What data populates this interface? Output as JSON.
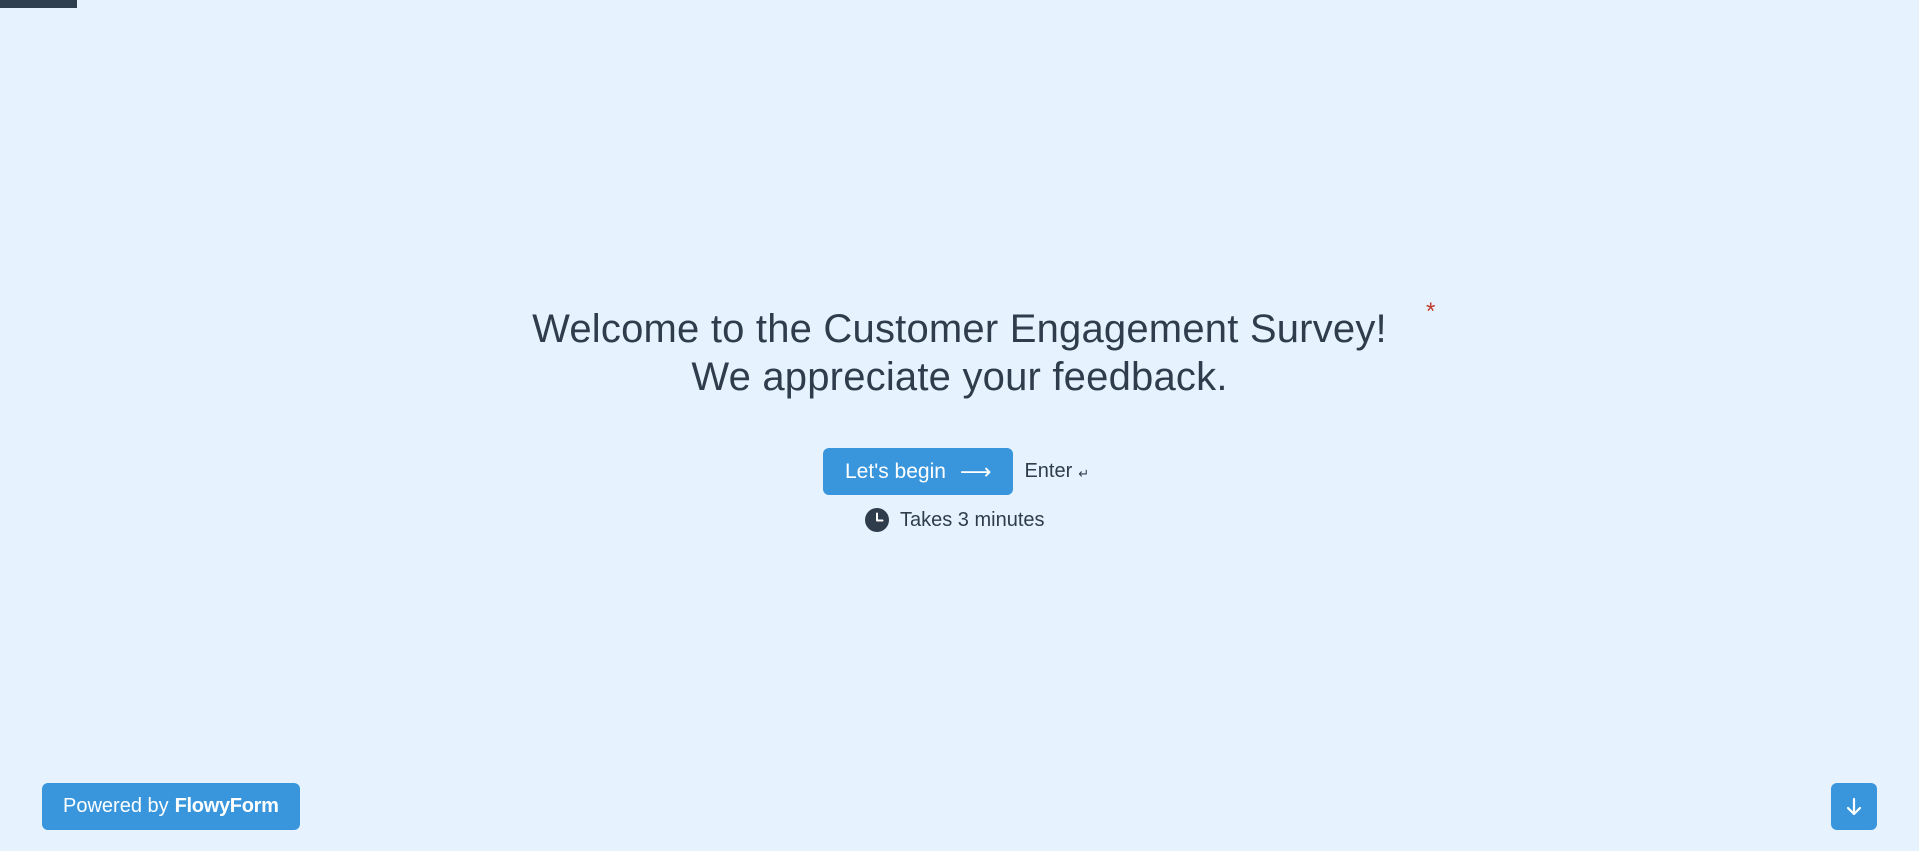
{
  "progress": {
    "fraction": 0.04
  },
  "welcome": {
    "title_line1": "Welcome to the Customer Engagement Survey!",
    "title_line2": "We appreciate your feedback.",
    "required_mark": "*"
  },
  "actions": {
    "begin_label": "Let's begin",
    "begin_arrow": "⟶",
    "enter_label": "Enter",
    "enter_icon": "↵"
  },
  "duration": {
    "text": "Takes 3 minutes",
    "icon": "clock-icon"
  },
  "footer": {
    "powered_prefix": "Powered by",
    "brand": "FlowyForm",
    "nav_down_icon": "arrow-down-icon"
  },
  "colors": {
    "background": "#e6f3fe",
    "accent": "#3996dc",
    "text": "#2e3c4c",
    "required": "#c0392b",
    "progress": "#2f3f50"
  }
}
